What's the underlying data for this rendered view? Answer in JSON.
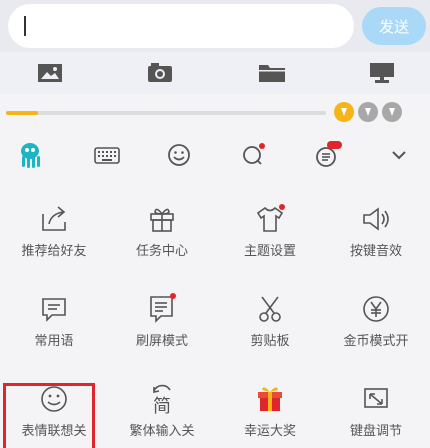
{
  "input": {
    "value": ""
  },
  "send_label": "发送",
  "progress": {
    "value": 0.1
  },
  "colors": {
    "accent": "#f5b418",
    "send": "#a9d9f6",
    "dot": "#e0262d",
    "icon": "#555555",
    "brand": "#1db5c6"
  },
  "toolbar": {
    "icons": [
      "octopus-logo-icon",
      "keyboard-icon",
      "emoji-icon",
      "search-icon",
      "bubble-settings-icon",
      "chevron-down-icon"
    ]
  },
  "grid": {
    "items": [
      {
        "label": "推荐给好友",
        "icon": "share-icon"
      },
      {
        "label": "任务中心",
        "icon": "gift-icon"
      },
      {
        "label": "主题设置",
        "icon": "shirt-icon"
      },
      {
        "label": "按键音效",
        "icon": "speaker-icon"
      },
      {
        "label": "常用语",
        "icon": "chat-bubble-icon"
      },
      {
        "label": "刷屏模式",
        "icon": "document-icon"
      },
      {
        "label": "剪贴板",
        "icon": "scissors-icon"
      },
      {
        "label": "金币模式开",
        "icon": "yen-coin-icon"
      },
      {
        "label": "表情联想关",
        "icon": "smiley-icon"
      },
      {
        "label": "繁体输入关",
        "icon": "traditional-char-icon"
      },
      {
        "label": "幸运大奖",
        "icon": "lucky-gift-icon"
      },
      {
        "label": "键盘调节",
        "icon": "keyboard-adjust-icon"
      }
    ]
  },
  "trad_glyph": "简"
}
